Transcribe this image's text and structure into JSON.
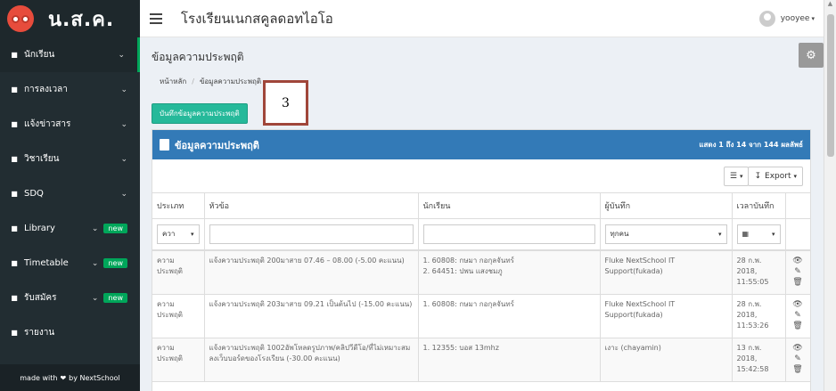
{
  "brand": {
    "title": "น.ส.ค."
  },
  "sidebar": {
    "items": [
      {
        "label": "นักเรียน",
        "icon": "users-icon",
        "new": false
      },
      {
        "label": "การลงเวลา",
        "icon": "clock-icon",
        "new": false
      },
      {
        "label": "แจ้งข่าวสาร",
        "icon": "bullhorn-icon",
        "new": false
      },
      {
        "label": "วิชาเรียน",
        "icon": "calendar-icon",
        "new": false
      },
      {
        "label": "SDQ",
        "icon": "clipboard-icon",
        "new": false
      },
      {
        "label": "Library",
        "icon": "book-icon",
        "new": true
      },
      {
        "label": "Timetable",
        "icon": "table-icon",
        "new": true
      },
      {
        "label": "รับสมัคร",
        "icon": "form-icon",
        "new": true
      },
      {
        "label": "รายงาน",
        "icon": "bar-chart-icon",
        "new": false
      }
    ],
    "new_badge": "new",
    "footer_prefix": "made with",
    "footer_suffix": "by NextSchool"
  },
  "topbar": {
    "school_name": "โรงเรียนเนกสคูลดอทไอโอ",
    "username": "yooyee"
  },
  "page": {
    "title": "ข้อมูลความประพฤติ",
    "breadcrumb": [
      "หน้าหลัก",
      "ข้อมูลความประพฤติ"
    ],
    "add_button": "บันทึกข้อมูลความประพฤติ",
    "annotation": "3"
  },
  "panel": {
    "title": "ข้อมูลความประพฤติ",
    "info": "แสดง 1 ถึง 14 จาก 144 ผลลัพธ์",
    "export_label": "Export",
    "columns": [
      "ประเภท",
      "หัวข้อ",
      "นักเรียน",
      "ผู้บันทึก",
      "เวลาบันทึก"
    ],
    "filters": {
      "type_value": "ควา",
      "recorder_value": "ทุกคน"
    },
    "rows": [
      {
        "type": "ความประพฤติ",
        "topic": "แจ้งความประพฤติ 200มาสาย 07.46 – 08.00 (-5.00 คะแนน)",
        "students": [
          "1. 60808: กษมา กอกุลจันทร์",
          "2. 64451: ปพน แสงชมภู"
        ],
        "recorder": "Fluke NextSchool IT Support(fukada)",
        "time": "28 ก.พ. 2018, 11:55:05"
      },
      {
        "type": "ความประพฤติ",
        "topic": "แจ้งความประพฤติ 203มาสาย 09.21 เป็นต้นไป (-15.00 คะแนน)",
        "students": [
          "1. 60808: กษมา กอกุลจันทร์"
        ],
        "recorder": "Fluke NextSchool IT Support(fukada)",
        "time": "28 ก.พ. 2018, 11:53:26"
      },
      {
        "type": "ความประพฤติ",
        "topic": "แจ้งความประพฤติ 1002อัพโหลดรูปภาพ/คลิปวีดีโอ/ที่ไม่เหมาะสมลงเว็บบอร์ดของโรงเรียน (-30.00 คะแนน)",
        "students": [
          "1. 12355: บอส 13mhz"
        ],
        "recorder": "เงาะ (chayamin)",
        "time": "13 ก.พ. 2018, 15:42:58"
      }
    ]
  },
  "colors": {
    "sidebar": "#222d32",
    "accent": "#26b99a",
    "panel_header": "#337ab7",
    "new_badge": "#00a65a"
  }
}
